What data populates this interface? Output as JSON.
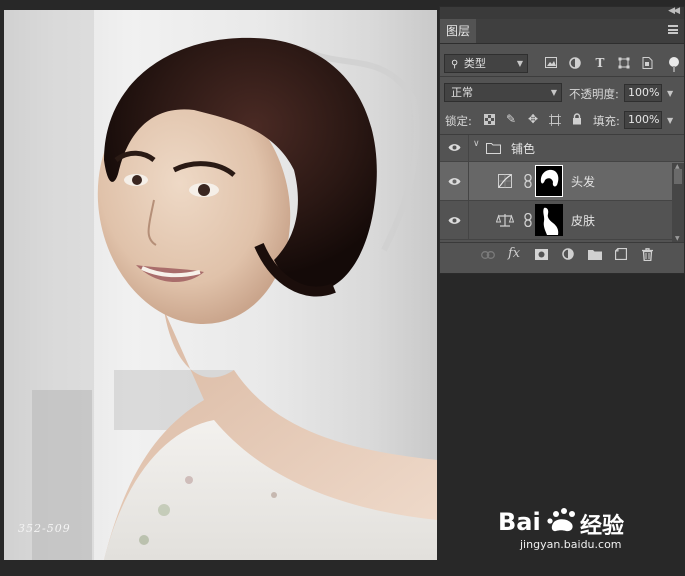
{
  "panel": {
    "tab_label": "图层",
    "filter": {
      "icon": "search-icon",
      "label": "类型"
    },
    "blend_mode": "正常",
    "opacity_label": "不透明度:",
    "opacity_value": "100%",
    "lock_label": "锁定:",
    "fill_label": "填充:",
    "fill_value": "100%",
    "layers": [
      {
        "name": "铺色",
        "type": "group",
        "visible": true
      },
      {
        "name": "头发",
        "type": "curves-adjustment",
        "visible": true,
        "selected": true
      },
      {
        "name": "皮肤",
        "type": "color-balance-adjustment",
        "visible": true
      }
    ],
    "bottom_icons": [
      "link-icon",
      "fx-icon",
      "mask-icon",
      "adjustment-icon",
      "folder-icon",
      "new-layer-icon",
      "trash-icon"
    ]
  },
  "canvas": {
    "caption": "352-509"
  },
  "watermark": {
    "logo": "Bai  经验",
    "site": "jingyan.baidu.com"
  },
  "colors": {
    "panel_bg": "#535353",
    "app_bg": "#282828",
    "selected_row": "#676767"
  }
}
